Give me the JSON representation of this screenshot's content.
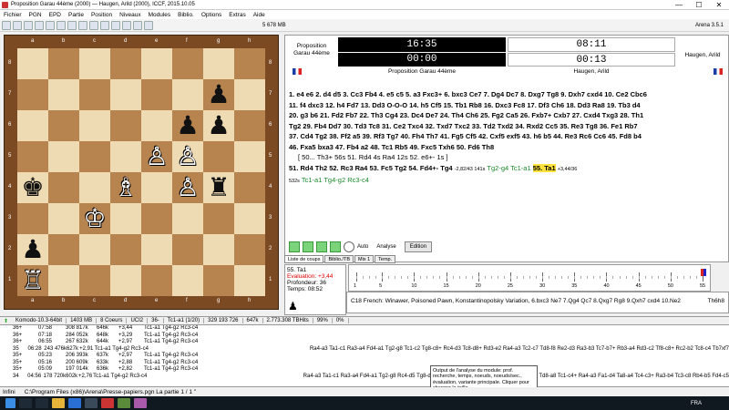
{
  "window": {
    "title": "Proposition Garau 44ème (2000) — Haugen, Arild (2000), ICCF, 2015.10.05",
    "minimize": "—",
    "maximize": "☐",
    "close": "✕"
  },
  "menu": [
    "Fichier",
    "PGN",
    "EPD",
    "Partie",
    "Position",
    "Niveaux",
    "Modules",
    "Biblio.",
    "Options",
    "Extras",
    "Aide"
  ],
  "toolbar": {
    "memory": "5 678 MB",
    "version": "Arena 3.5.1"
  },
  "board": {
    "files": [
      "a",
      "b",
      "c",
      "d",
      "e",
      "f",
      "g",
      "h"
    ],
    "ranks": [
      "8",
      "7",
      "6",
      "5",
      "4",
      "3",
      "2",
      "1"
    ],
    "pieces": [
      {
        "sq": "g7",
        "glyph": "♟",
        "color": "b"
      },
      {
        "sq": "f6",
        "glyph": "♟",
        "color": "b"
      },
      {
        "sq": "g6",
        "glyph": "♟",
        "color": "b"
      },
      {
        "sq": "e5",
        "glyph": "♙",
        "color": "w"
      },
      {
        "sq": "f5",
        "glyph": "♙",
        "color": "w"
      },
      {
        "sq": "a4",
        "glyph": "♚",
        "color": "b"
      },
      {
        "sq": "d4",
        "glyph": "♗",
        "color": "w"
      },
      {
        "sq": "f4",
        "glyph": "♙",
        "color": "w"
      },
      {
        "sq": "g4",
        "glyph": "♜",
        "color": "b"
      },
      {
        "sq": "c3",
        "glyph": "♔",
        "color": "w"
      },
      {
        "sq": "a2",
        "glyph": "♟",
        "color": "b"
      },
      {
        "sq": "a1",
        "glyph": "♖",
        "color": "w"
      }
    ]
  },
  "players": {
    "white_name": "Proposition Garau 44ème",
    "white_label": "Proposition Garau 44ème",
    "white_clock": "16:35",
    "white_clock2": "00:00",
    "black_name": "Haugen, Arild",
    "black_label": "Haugen, Arild",
    "black_clock": "08:11",
    "black_clock2": "00:13"
  },
  "notation": {
    "line1": "1. e4 e6 2. d4 d5 3. Cc3 Fb4 4. e5 c5 5. a3 Fxc3+ 6. bxc3 Ce7 7. Dg4 Dc7 8. Dxg7 Tg8 9. Dxh7 cxd4 10. Ce2 Cbc6",
    "line2": "11. f4 dxc3 12. h4 Fd7 13. Dd3 O-O-O 14. h5 Cf5 15. Tb1 Rb8 16. Dxc3 Fc8 17. Df3 Ch6 18. Dd3 Ra8 19. Tb3 d4",
    "line3": "20. g3 b6 21. Fd2 Fb7 22. Th3 Cg4 23. Dc4 De7 24. Th4 Ch6 25. Fg2 Ca5 26. Fxb7+ Cxb7 27. Cxd4 Txg3 28. Th1",
    "line4": "Tg2 29. Fb4 Dd7 30. Td3 Tc8 31. Ce2 Txc4 32. Txd7 Txc2 33. Td2 Txd2 34. Rxd2 Cc5 35. Re3 Tg8 36. Fe1 Rb7",
    "line5": "37. Cd4 Tg2 38. Ff2 a5 39. Rf3 Tg7 40. Fh4 Th7 41. Fg5 Cf5 42. Cxf5 exf5 43. h6 b5 44. Re3",
    "line5b": "Rc6",
    "line5c": "Cc6 45. Fd8",
    "line5d": "b4",
    "line6a": "46. Fxa5",
    "line6b": "bxa3",
    "line6c": "47. Fb4",
    "line6d": "a2",
    "line6e": "48. Tc1",
    "line6f": "Rb5",
    "line6g": "49. Fxc5",
    "line6h": "Txh6",
    "line6i": "50. Fd6",
    "line6j": "Th8",
    "variation": "[ 50... Th3+ 56s 51. Rd4 4s Ra4 12s 52. e6+- 1s ]",
    "line8a": "51. Rd4",
    "line8b": "Th2",
    "line8c": "52. Rc3",
    "line8d": "Ra4",
    "line8e": "53. Fc5",
    "line8f": "Tg2",
    "line8g": "54. Fd4+-",
    "line8h": "Tg4",
    "line8i": "-2,82/43 141s",
    "line8j": "Tg2-g4 Tc1-a1",
    "line8k": "55. Ta1",
    "line8l": "+3,44/36",
    "line9a": "532s",
    "line9b": "Tc1-a1 Tg4-g2 Rc3-c4"
  },
  "nav": {
    "auto": "Auto",
    "analyse": "Analyse",
    "edition": "Edition"
  },
  "tabs": [
    "Liste de coups",
    "Biblio./TB",
    "Mix 1",
    "Temp."
  ],
  "evalbox": {
    "move": "55. Ta1",
    "evaluation": "Evaluation: +3,44",
    "depth": "Profondeur: 36",
    "time": "Temps: 08:52"
  },
  "graph": {
    "ticks": [
      "1",
      "5",
      "10",
      "15",
      "20",
      "25",
      "30",
      "35",
      "40",
      "45",
      "50",
      "55"
    ]
  },
  "opening": {
    "text": "C18  French: Winawer, Poisoned Pawn, Konstantinopolsky Variation, 6.bxc3 Ne7 7.Qg4 Qc7 8.Qxg7 Rg8 9.Qxh7 cxd4 10.Ne2",
    "right": "Th6h8"
  },
  "engine": {
    "name": "Komodo-10.3-64bit",
    "hash": "1403 MB",
    "cores": "8 Coeurs",
    "uci": "UCI2",
    "depth": "36-",
    "move": "Tc1-a1 (1/20)",
    "nodes": "329 193 726",
    "nps": "647k",
    "tbhits": "2.773.308 TBHits",
    "cpu": "99%",
    "hashfull": "0%"
  },
  "analysis": [
    [
      "36+",
      "07:58",
      "308 817k",
      "646k",
      "+3,44",
      "Tc1-a1 Tg4-g2 Rc3-c4",
      ""
    ],
    [
      "36+",
      "07:18",
      "284 052k",
      "648k",
      "+3,29",
      "Tc1-a1 Tg4-g2 Rc3-c4",
      ""
    ],
    [
      "36+",
      "06:55",
      "267 632k",
      "644k",
      "+2,97",
      "Tc1-a1 Tg4-g2 Rc3-c4",
      ""
    ],
    [
      "35",
      "06:28",
      "243 476k",
      "627k",
      "+2,91",
      "Tc1-a1 Tg4-g2 Rc3-c4",
      "Ra4-a3 Ta1-c1 Ra3-a4 Fd4-a1 Tg2-g8 Tc1-c2 Tg8-c8+ Rc4-d3 Tc8-d8+ Rd3-e2 Ra4-a3 Tc2-c7 Td8-f8 Re2-d3 Ra3-b3 Tc7-b7+ Rb3-a4 Rd3-c2 Tf8-c8+ Rc2-b2 Tc8-c4 Tb7xf7"
    ],
    [
      "35+",
      "05:23",
      "206 393k",
      "637k",
      "+2,97",
      "Tc1-a1 Tg4-g2 Rc3-c4",
      ""
    ],
    [
      "35+",
      "05:16",
      "200 609k",
      "633k",
      "+2,88",
      "Tc1-a1 Tg4-g2 Rc3-c4",
      ""
    ],
    [
      "35+",
      "05:09",
      "197 014k",
      "636k",
      "+2,82",
      "Tc1-a1 Tg4-g2 Rc3-c4",
      ""
    ],
    [
      "34",
      "04:56",
      "178 720k",
      "602k",
      "+2,76",
      "Tc1-a1 Tg4-g2 Rc3-c4",
      "Ra4-a3 Ta1-c1 Ra3-a4 Fd4-a1 Tg2-g8 Rc4-d5 Tg8-d8+ Rd5-c6 Td8-c8+ Rc6-d6 Tc8-d8+ Rd6-e7 Td8-a8 Tc1-c4+ Ra4-a3 Fa1-d4 Ta8-a4 Tc4-c3+ Ra3-b4 Tc3-c8 Rb4-b5 Fd4-c5"
    ]
  ],
  "tooltip": "Output de l'analyse du module: prof. recherche, temps, noeuds, noeuds/sec., évaluation, variante principale. Cliquer pour changer la taille",
  "status": {
    "mode": "Infini",
    "path": "C:\\Program Files (x86)\\Arena\\Presse-papiers.pgn  La partie 1 / 1 \""
  },
  "taskbar": {
    "lang": "FRA"
  },
  "colors": {
    "light": "#eedbb4",
    "dark": "#b78450",
    "green": "#1a8a2a",
    "highlight": "#ffe23a"
  }
}
